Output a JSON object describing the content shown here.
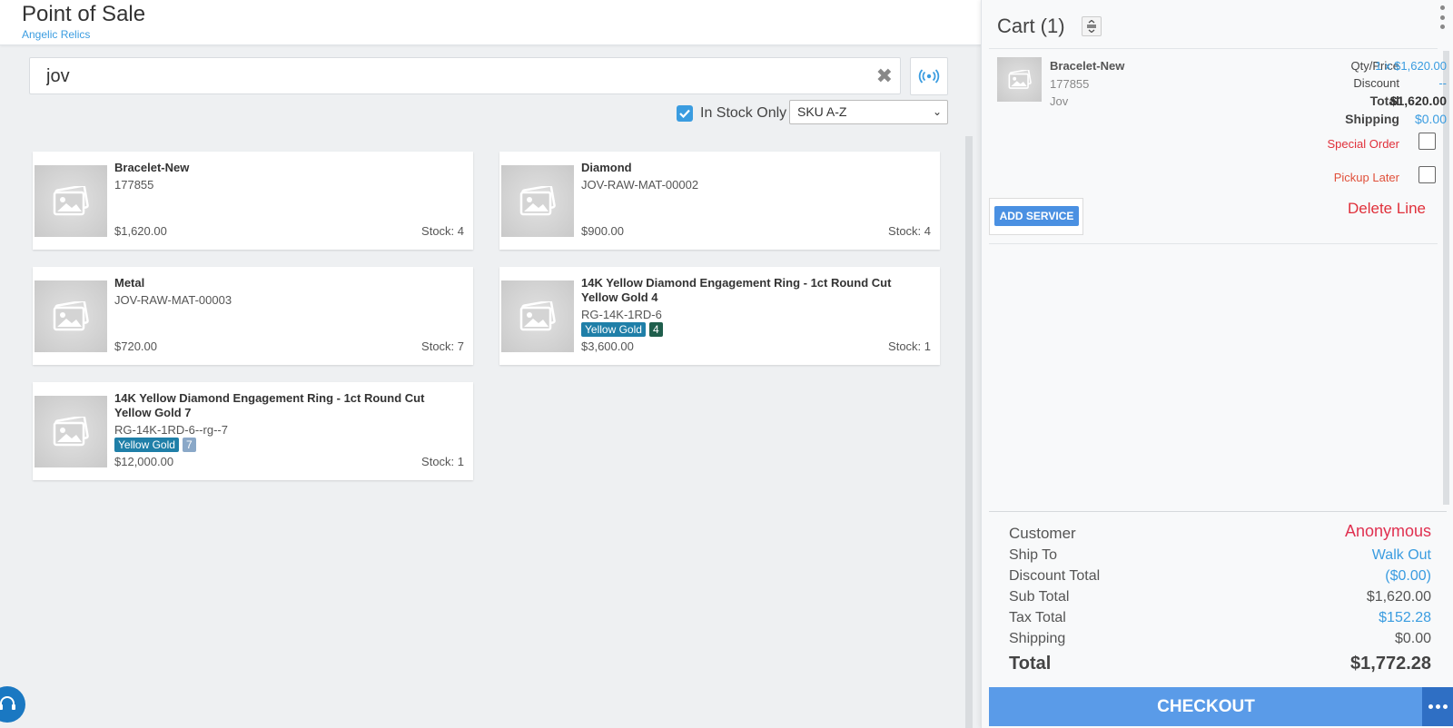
{
  "header": {
    "title": "Point of Sale",
    "store": "Angelic Relics"
  },
  "search": {
    "value": "jov",
    "placeholder": ""
  },
  "filters": {
    "in_stock_label": "In Stock Only",
    "in_stock_checked": true,
    "sort_value": "SKU A-Z"
  },
  "products": [
    {
      "name": "Bracelet-New",
      "sku": "177855",
      "price": "$1,620.00",
      "stock": "Stock: 4",
      "badges": []
    },
    {
      "name": "Diamond",
      "sku": "JOV-RAW-MAT-00002",
      "price": "$900.00",
      "stock": "Stock: 4",
      "badges": []
    },
    {
      "name": "Metal",
      "sku": "JOV-RAW-MAT-00003",
      "price": "$720.00",
      "stock": "Stock: 7",
      "badges": []
    },
    {
      "name": "14K Yellow Diamond Engagement Ring - 1ct Round Cut Yellow Gold 4",
      "sku": "RG-14K-1RD-6",
      "price": "$3,600.00",
      "stock": "Stock: 1",
      "badges": [
        "Yellow Gold",
        "4"
      ]
    },
    {
      "name": "14K Yellow Diamond Engagement Ring - 1ct Round Cut Yellow Gold 7",
      "sku": "RG-14K-1RD-6--rg--7",
      "price": "$12,000.00",
      "stock": "Stock: 1",
      "badges": [
        "Yellow Gold",
        "7"
      ]
    }
  ],
  "cart": {
    "title": "Cart (1)",
    "line": {
      "name": "Bracelet-New",
      "sku": "177855",
      "vendor": "Jov",
      "qty_price_label": "Qty/Price",
      "qty_price_value": "1 x $1,620.00",
      "discount_label": "Discount",
      "discount_value": "--",
      "total_label": "Total",
      "total_value": "$1,620.00",
      "shipping_label": "Shipping",
      "shipping_value": "$0.00",
      "special_order_label": "Special Order",
      "pickup_later_label": "Pickup Later",
      "add_service_label": "ADD SERVICE",
      "delete_line_label": "Delete Line"
    },
    "summary": {
      "customer_label": "Customer",
      "customer_value": "Anonymous",
      "ship_to_label": "Ship To",
      "ship_to_value": "Walk Out",
      "discount_total_label": "Discount Total",
      "discount_total_value": "($0.00)",
      "sub_total_label": "Sub Total",
      "sub_total_value": "$1,620.00",
      "tax_total_label": "Tax Total",
      "tax_total_value": "$152.28",
      "shipping_label": "Shipping",
      "shipping_value": "$0.00",
      "total_label": "Total",
      "total_value": "$1,772.28"
    },
    "checkout_label": "CHECKOUT"
  },
  "colors": {
    "accent": "#3a9ce0",
    "checkout": "#5a9be8",
    "danger": "#e0303a",
    "badge_gold": "#1f7fa8"
  }
}
